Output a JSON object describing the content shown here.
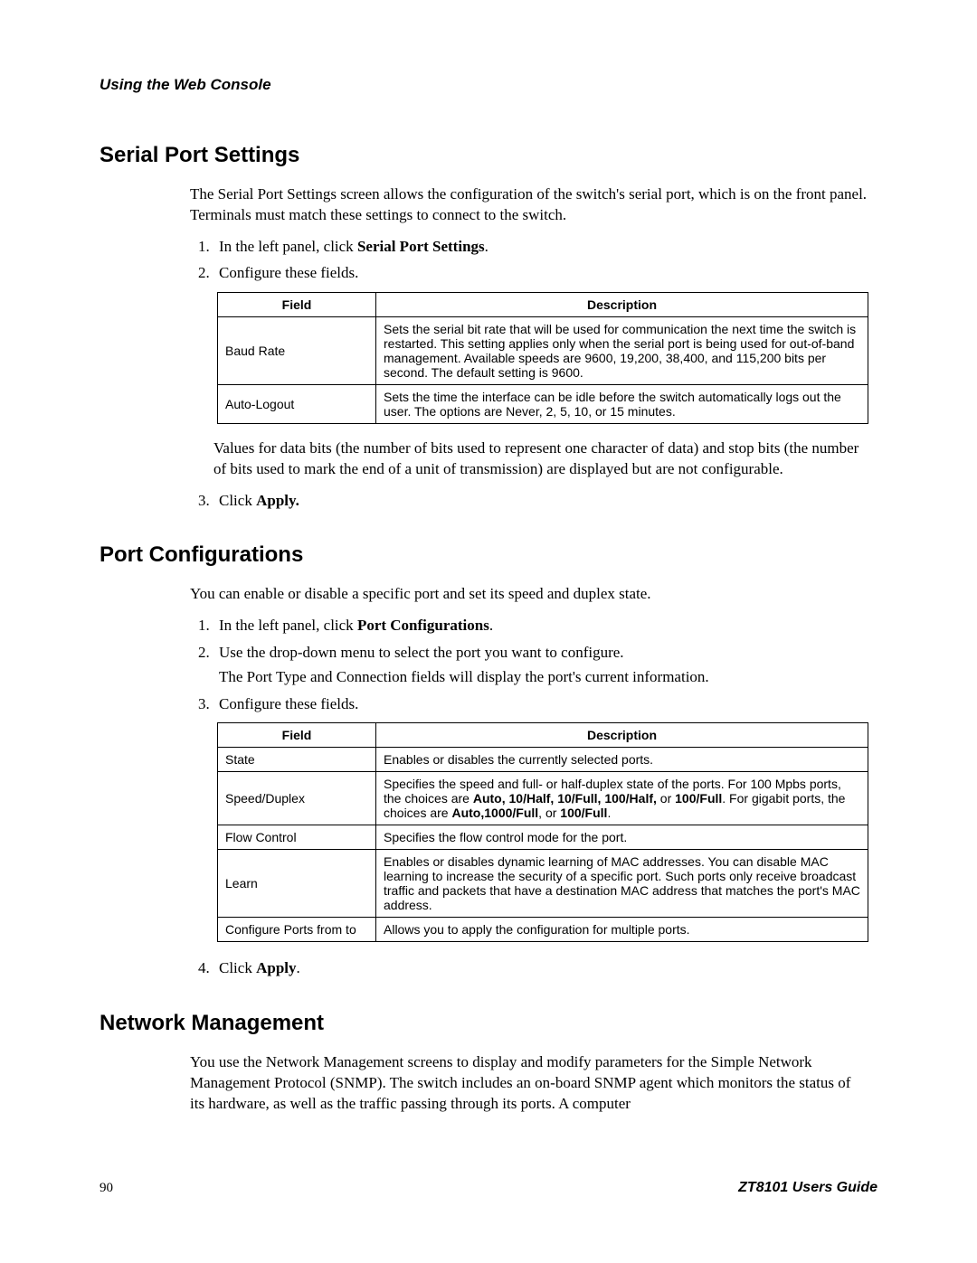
{
  "header": {
    "chapter": "Using the Web Console"
  },
  "sections": {
    "serial": {
      "title": "Serial Port Settings",
      "intro": "The Serial Port Settings screen allows the configuration of the switch's serial port, which is on the front panel. Terminals must match these settings to connect to the switch.",
      "step1_pre": "In the left panel, click ",
      "step1_bold": "Serial Port Settings",
      "step1_post": ".",
      "step2": "Configure these fields.",
      "note": "Values for data bits (the number of bits used to represent one character of data) and stop bits (the number of bits used to mark the end of a unit of transmission) are displayed but are not configurable.",
      "step3_pre": "Click ",
      "step3_bold": "Apply."
    },
    "portconf": {
      "title": "Port Configurations",
      "intro": "You can enable or disable a specific port and set its speed and duplex state.",
      "step1_pre": "In the left panel, click ",
      "step1_bold": "Port Configurations",
      "step1_post": ".",
      "step2": "Use the drop-down menu to select the port you want to configure.",
      "step2_sub": "The Port Type and Connection fields will display the port's current information.",
      "step3": "Configure these fields.",
      "step4_pre": "Click ",
      "step4_bold": "Apply",
      "step4_post": "."
    },
    "netmgmt": {
      "title": "Network Management",
      "intro": "You use the Network Management screens to display and modify parameters for the Simple Network Management Protocol (SNMP). The switch includes an on-board SNMP agent which monitors the status of its hardware, as well as the traffic passing through its ports. A computer"
    }
  },
  "tables": {
    "headers": {
      "field": "Field",
      "description": "Description"
    },
    "serial": {
      "rows": [
        {
          "field": "Baud Rate",
          "desc": "Sets the serial bit rate that will be used for communication the next time the switch is restarted. This setting applies only when the serial port is being used for out-of-band management. Available speeds are 9600, 19,200, 38,400, and 115,200 bits per second. The default setting is 9600."
        },
        {
          "field": "Auto-Logout",
          "desc": "Sets the time the interface can be idle before the switch automatically logs out the user. The options are Never, 2, 5, 10, or 15 minutes."
        }
      ]
    },
    "portconf": {
      "rows": [
        {
          "field": "State",
          "desc": "Enables or disables the currently selected ports."
        },
        {
          "field": "Speed/Duplex",
          "desc_pre": "Specifies the speed and full- or half-duplex state of the ports. For 100 Mpbs ports, the choices are ",
          "b1": "Auto, 10/Half, 10/Full, 100/Half,",
          "mid1": " or ",
          "b2": "100/Full",
          "mid2": ". For gigabit ports, the choices are ",
          "b3": "Auto,1000/Full",
          "mid3": ", or ",
          "b4": "100/Full",
          "post": "."
        },
        {
          "field": "Flow Control",
          "desc": "Specifies the flow control mode for the port."
        },
        {
          "field": "Learn",
          "desc": "Enables or disables dynamic learning of MAC addresses. You can disable MAC learning to increase the security of a specific port. Such ports only receive broadcast traffic and packets that have a destination MAC address that matches the port's MAC address."
        },
        {
          "field": "Configure Ports from to",
          "desc": "Allows you to apply the configuration for multiple ports."
        }
      ]
    }
  },
  "footer": {
    "page": "90",
    "guide": "ZT8101 Users Guide"
  }
}
